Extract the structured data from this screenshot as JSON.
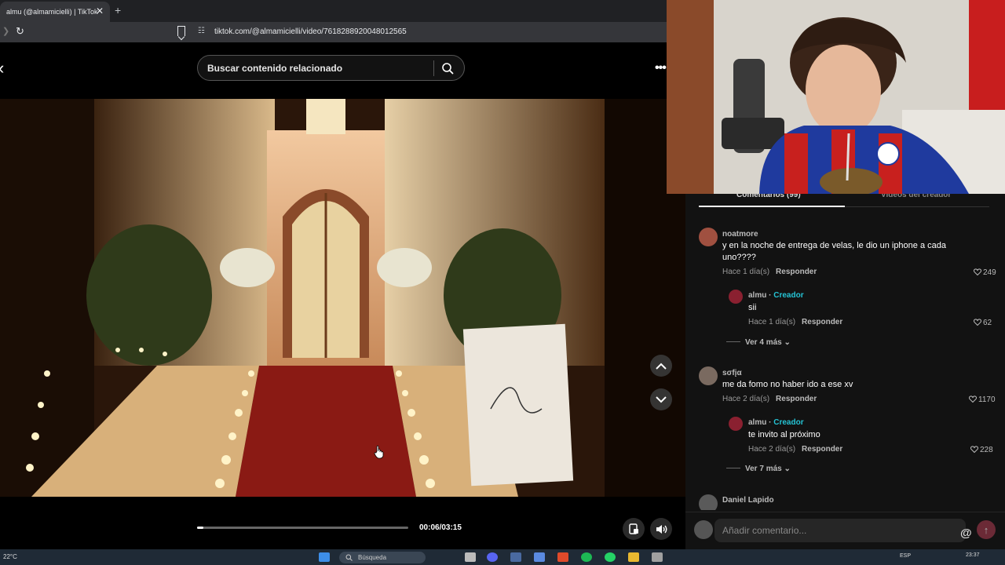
{
  "browser": {
    "tab_title": "almu (@almamicielli) | TikTok",
    "tab_close": "✕",
    "new_tab": "+",
    "url": "tiktok.com/@almamicielli/video/7618288920048012565"
  },
  "search": {
    "placeholder": "Buscar contenido relacionado"
  },
  "player": {
    "time": "00:06/03:15",
    "progress_fraction": 0.031
  },
  "comments_panel": {
    "tab_comments": "Comentarios (99)",
    "tab_videos": "Videos del creador",
    "reply_label": "Responder",
    "creator_label": "Creador",
    "items": [
      {
        "user": "noatmore",
        "text": "y en la noche de entrega de velas, le dio un iphone a cada uno????",
        "time": "Hace 1 día(s)",
        "likes": "249",
        "reply": {
          "user": "almu",
          "text": "sii",
          "time": "Hace 1 día(s)",
          "likes": "62"
        },
        "more": "Ver 4 más"
      },
      {
        "user": "sσfįα",
        "text": "me da fomo no haber ido a ese xv",
        "time": "Hace 2 día(s)",
        "likes": "1170",
        "reply": {
          "user": "almu",
          "text": "te invito al próximo",
          "time": "Hace 2 día(s)",
          "likes": "228"
        },
        "more": "Ver 7 más"
      },
      {
        "user": "Daniel Lapido"
      }
    ],
    "comment_placeholder": "Añadir comentario...",
    "at_symbol": "@"
  },
  "taskbar": {
    "weather": "22°C",
    "search": "Búsqueda",
    "lang": "ESP",
    "clock": "23:37"
  },
  "colors": {
    "creator_accent": "#25c4d5",
    "panel_bg": "#121212"
  }
}
